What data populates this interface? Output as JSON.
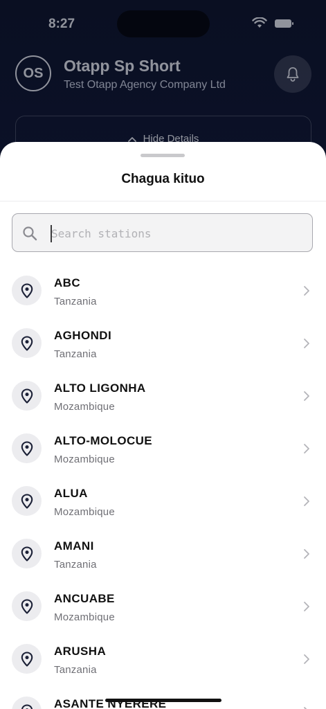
{
  "status_bar": {
    "time": "8:27"
  },
  "header": {
    "avatar_initials": "OS",
    "user_name": "Otapp Sp Short",
    "company_name": "Test Otapp Agency Company Ltd"
  },
  "details": {
    "toggle_label": "Hide Details"
  },
  "sheet": {
    "title": "Chagua kituo",
    "search": {
      "placeholder": "Search stations",
      "value": ""
    },
    "stations": [
      {
        "name": "ABC",
        "country": "Tanzania"
      },
      {
        "name": "AGHONDI",
        "country": "Tanzania"
      },
      {
        "name": "ALTO LIGONHA",
        "country": "Mozambique"
      },
      {
        "name": "ALTO-MOLOCUE",
        "country": "Mozambique"
      },
      {
        "name": "ALUA",
        "country": "Mozambique"
      },
      {
        "name": "AMANI",
        "country": "Tanzania"
      },
      {
        "name": "ANCUABE",
        "country": "Mozambique"
      },
      {
        "name": "ARUSHA",
        "country": "Tanzania"
      },
      {
        "name": "ASANTE NYERERE",
        "country": ""
      }
    ]
  },
  "icons": {
    "station": "map-pin-icon",
    "row_action": "chevron-right-icon",
    "search": "search-icon",
    "notifications": "bell-icon"
  },
  "colors": {
    "background": "#0d1430",
    "sheet": "#ffffff",
    "pin": "#1b2036",
    "muted_text": "#6f6f75"
  }
}
